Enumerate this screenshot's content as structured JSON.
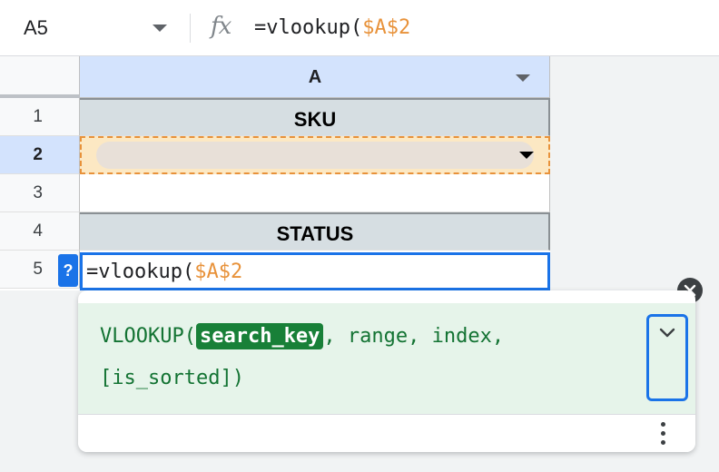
{
  "formula_bar": {
    "cell_ref": "A5",
    "fx_label": "fx",
    "formula_prefix": "=vlookup(",
    "formula_ref": "$A$2"
  },
  "grid": {
    "column_label": "A",
    "rows": [
      "1",
      "2",
      "3",
      "4",
      "5"
    ],
    "active_row": "2",
    "cells": {
      "row1": "SKU",
      "row4": "STATUS"
    },
    "edit_cell": {
      "prefix": "=vlookup(",
      "ref": "$A$2"
    },
    "help_toggle": "?"
  },
  "tooltip": {
    "fn_name": "VLOOKUP(",
    "active_param": "search_key",
    "rest_line1": ", range, index,",
    "line2": "[is_sorted])",
    "expand_icon": "chevron-down-icon",
    "more_icon": "more-vert-icon",
    "close_icon": "close-icon"
  },
  "colors": {
    "accent": "#1a73e8",
    "reference": "#e8923a",
    "tooltip_bg": "#e6f4ea",
    "param_active": "#188038"
  }
}
